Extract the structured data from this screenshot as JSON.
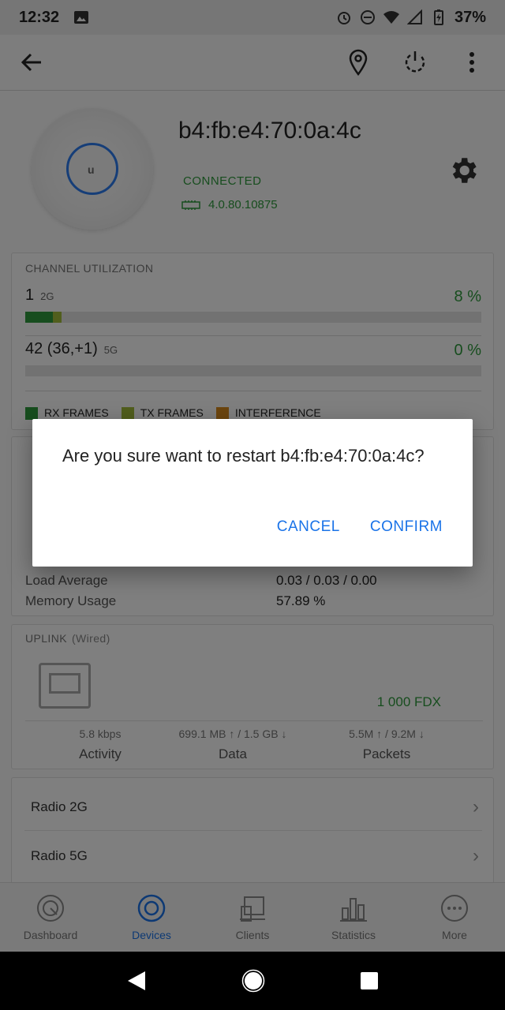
{
  "status_bar": {
    "time": "12:32",
    "battery": "37%"
  },
  "device": {
    "name": "b4:fb:e4:70:0a:4c",
    "status": "CONNECTED",
    "firmware": "4.0.80.10875"
  },
  "channel_utilization": {
    "title": "CHANNEL UTILIZATION",
    "rows": [
      {
        "channel": "1",
        "band": "2G",
        "percent": "8 %",
        "rx_fraction": 0.06,
        "tx_fraction": 0.02
      },
      {
        "channel": "42 (36,+1)",
        "band": "5G",
        "percent": "0 %",
        "rx_fraction": 0,
        "tx_fraction": 0
      }
    ],
    "legend": [
      {
        "label": "RX FRAMES",
        "color": "#2e9b3c"
      },
      {
        "label": "TX FRAMES",
        "color": "#a3bd3a"
      },
      {
        "label": "INTERFERENCE",
        "color": "#d98a1c"
      }
    ]
  },
  "details": {
    "rows": [
      {
        "label": "Load Average",
        "value": "0.03 / 0.03 / 0.00"
      },
      {
        "label": "Memory Usage",
        "value": "57.89 %"
      }
    ]
  },
  "uplink": {
    "title": "UPLINK",
    "type": "(Wired)",
    "speed": "1 000 FDX",
    "stats": [
      {
        "value": "5.8 kbps",
        "label": "Activity"
      },
      {
        "value": "699.1 MB ↑ / 1.5 GB ↓",
        "label": "Data"
      },
      {
        "value": "5.5M ↑ / 9.2M ↓",
        "label": "Packets"
      }
    ]
  },
  "radios": [
    {
      "label": "Radio 2G"
    },
    {
      "label": "Radio 5G"
    }
  ],
  "bottom_nav": [
    {
      "label": "Dashboard",
      "icon": "dashboard-icon",
      "active": false
    },
    {
      "label": "Devices",
      "icon": "devices-icon",
      "active": true
    },
    {
      "label": "Clients",
      "icon": "clients-icon",
      "active": false
    },
    {
      "label": "Statistics",
      "icon": "statistics-icon",
      "active": false
    },
    {
      "label": "More",
      "icon": "more-icon",
      "active": false
    }
  ],
  "dialog": {
    "message": "Are you sure want to restart b4:fb:e4:70:0a:4c?",
    "cancel": "CANCEL",
    "confirm": "CONFIRM"
  },
  "colors": {
    "accent": "#1a73e8",
    "success": "#2e9b3c"
  }
}
